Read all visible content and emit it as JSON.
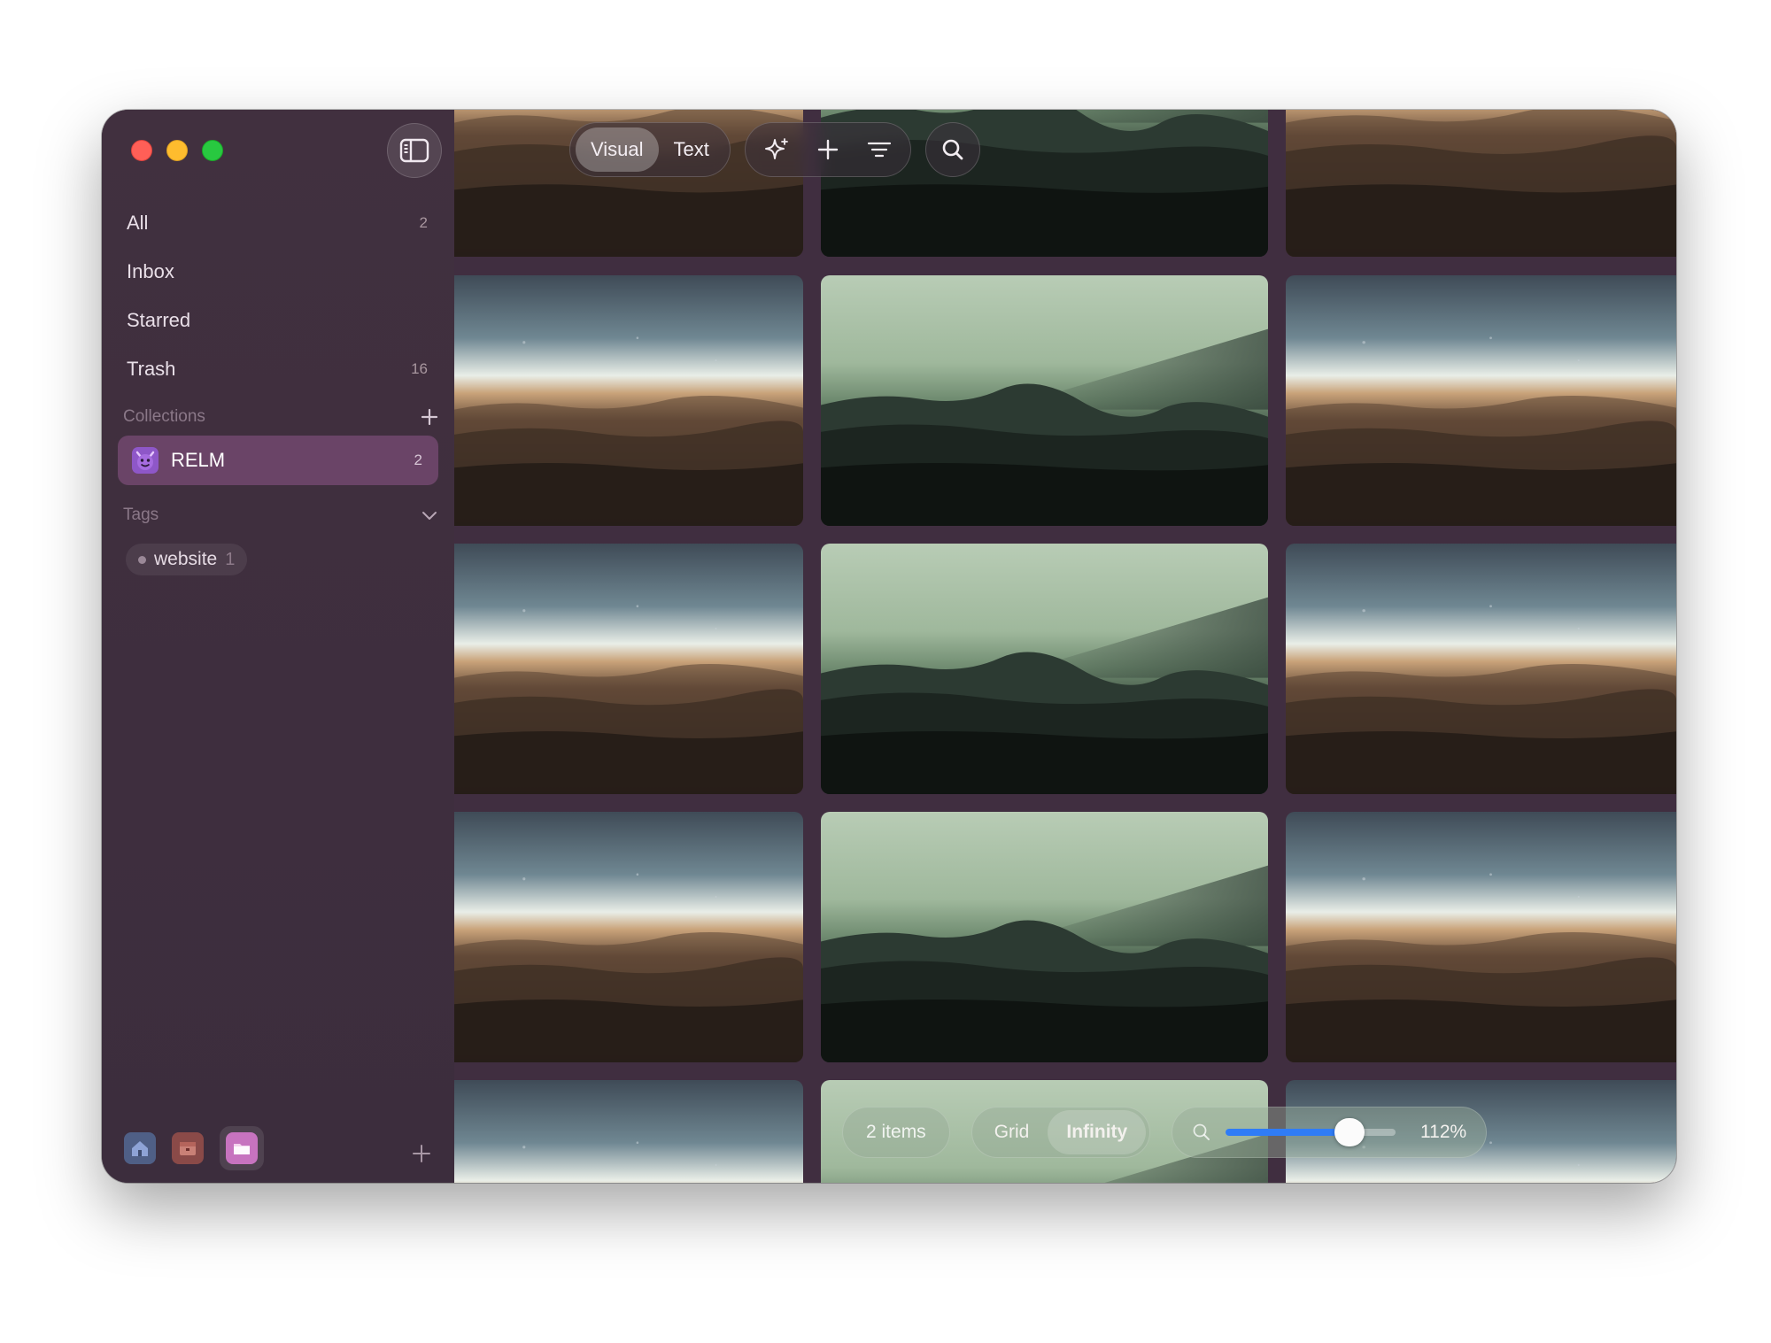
{
  "sidebar": {
    "nav": [
      {
        "label": "All",
        "count": "2"
      },
      {
        "label": "Inbox",
        "count": ""
      },
      {
        "label": "Starred",
        "count": ""
      },
      {
        "label": "Trash",
        "count": "16"
      }
    ],
    "collections_heading": "Collections",
    "collection": {
      "name": "RELM",
      "count": "2",
      "icon": "devil-emoji-icon"
    },
    "tags_heading": "Tags",
    "tag": {
      "name": "website",
      "count": "1"
    },
    "bottom_icons": [
      "home-icon",
      "box-icon",
      "folder-icon"
    ]
  },
  "toolbar": {
    "visual_label": "Visual",
    "text_label": "Text",
    "active_mode": "Visual",
    "icons": [
      "sparkle-icon",
      "plus-icon",
      "filter-icon",
      "search-icon"
    ]
  },
  "bottombar": {
    "items_label": "2 items",
    "grid_label": "Grid",
    "infinity_label": "Infinity",
    "active_view": "Infinity",
    "zoom_text": "112%",
    "zoom_level": 0.73
  },
  "colors": {
    "accent": "#2f7cf6",
    "selected_collection": "#6a4467",
    "sidebar_bg": "#3c2d3d"
  }
}
